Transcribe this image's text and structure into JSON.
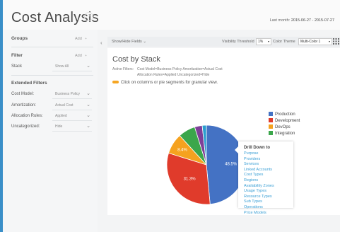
{
  "header": {
    "title": "Cost Analysis",
    "help_icon": "?",
    "range_label": "Last month:",
    "range_value": "2015-06-27 - 2015-07-27"
  },
  "sidebar": {
    "groups": {
      "label": "Groups",
      "add": "Add",
      "add_icon": "+"
    },
    "filter": {
      "label": "Filter",
      "add": "Add",
      "add_icon": "+",
      "items": [
        {
          "label": "Stack",
          "value": "Show All"
        }
      ]
    },
    "extended": {
      "label": "Extended Filters",
      "items": [
        {
          "label": "Cost Model:",
          "value": "Business Policy"
        },
        {
          "label": "Amortization:",
          "value": "Actual Cost"
        },
        {
          "label": "Allocation Rules:",
          "value": "Applied"
        },
        {
          "label": "Uncategorized:",
          "value": "Hide"
        }
      ]
    }
  },
  "toolbar": {
    "collapse_icon": "‹",
    "show_fields": "Show/Hide Fields",
    "show_fields_chev": "⌄",
    "threshold_label": "Visibility Threshold",
    "threshold_value": "1%",
    "theme_label": "Color Theme",
    "theme_value": "Multi-Color 1"
  },
  "panel": {
    "title": "Cost by Stack",
    "filters_label": "Active Filters:",
    "filters_line1": "Cost Model=Business Policy     Amortization=Actual Cost",
    "filters_line2": "Allocation Rules=Applied     Uncategorized=Hide",
    "hint": "Click on columns or pie segments for granular view."
  },
  "chart_data": {
    "type": "pie",
    "title": "",
    "slices": [
      {
        "label": "Production",
        "value": 48.5,
        "color": "#4472c4"
      },
      {
        "label": "Development",
        "value": 31.3,
        "color": "#e03b2b"
      },
      {
        "label": "DevOps",
        "value": 8.4,
        "color": "#f5a21f"
      },
      {
        "label": "Integration",
        "value": 7.0,
        "color": "#3ba64b"
      },
      {
        "label": "",
        "value": 3.1,
        "color": "#7e3f98"
      },
      {
        "label": "",
        "value": 1.7,
        "color": "#2a9ecf"
      }
    ],
    "data_labels": [
      "48.5%",
      "31.3%",
      "8.4%"
    ],
    "legend_position": "right"
  },
  "drill": {
    "title": "Drill Down to",
    "items": [
      "Purpose",
      "Providers",
      "Services",
      "Linked Accounts",
      "Cost Types",
      "Regions",
      "Availability Zones",
      "Usage Types",
      "Resource Types",
      "Sub Types",
      "Operations",
      "Price Models"
    ]
  }
}
